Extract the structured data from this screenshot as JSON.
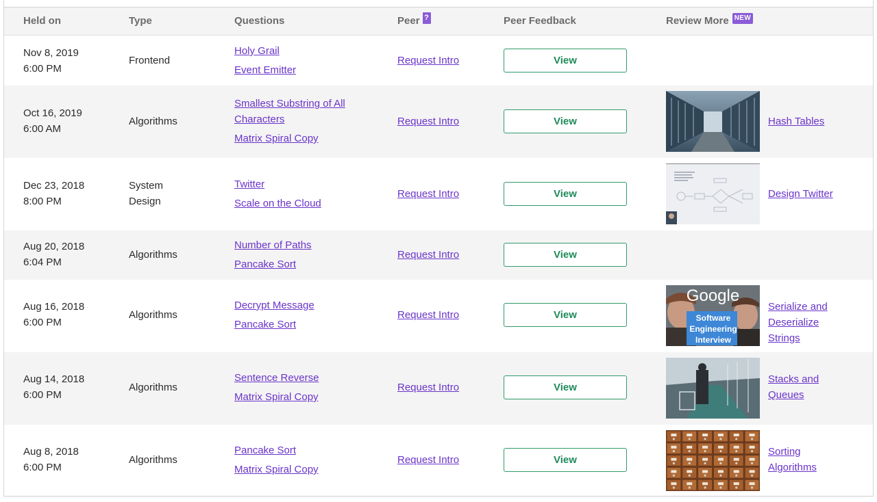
{
  "headers": {
    "held_on": "Held on",
    "type": "Type",
    "questions": "Questions",
    "peer": "Peer",
    "peer_help": "?",
    "peer_feedback": "Peer Feedback",
    "review_more": "Review More",
    "new_badge": "NEW"
  },
  "rows": [
    {
      "date": "Nov 8, 2019",
      "time": "6:00 PM",
      "type": "Frontend",
      "questions": [
        "Holy Grail",
        "Event Emitter"
      ],
      "peer": "Request Intro",
      "feedback": "View",
      "review": null
    },
    {
      "date": "Oct 16, 2019",
      "time": "6:00 AM",
      "type": "Algorithms",
      "questions": [
        "Smallest Substring of All Characters",
        "Matrix Spiral Copy"
      ],
      "peer": "Request Intro",
      "feedback": "View",
      "review": {
        "lines": [
          "Hash Tables"
        ],
        "thumb": "server-room-thumbnail"
      }
    },
    {
      "date": "Dec 23, 2018",
      "time": "8:00 PM",
      "type": "System Design",
      "questions": [
        "Twitter",
        "Scale on the Cloud"
      ],
      "peer": "Request Intro",
      "feedback": "View",
      "review": {
        "lines": [
          "Design Twitter"
        ],
        "thumb": "diagram-thumbnail"
      }
    },
    {
      "date": "Aug 20, 2018",
      "time": "6:04 PM",
      "type": "Algorithms",
      "questions": [
        "Number of Paths",
        "Pancake Sort"
      ],
      "peer": "Request Intro",
      "feedback": "View",
      "review": null
    },
    {
      "date": "Aug 16, 2018",
      "time": "6:00 PM",
      "type": "Algorithms",
      "questions": [
        "Decrypt Message",
        "Pancake Sort"
      ],
      "peer": "Request Intro",
      "feedback": "View",
      "review": {
        "lines": [
          "Serialize and",
          "Deserialize",
          "Strings"
        ],
        "thumb": "google-interview-thumbnail",
        "thumb_text": {
          "brand": "Google",
          "l1": "Software",
          "l2": "Engineering",
          "l3": "Interview"
        }
      }
    },
    {
      "date": "Aug 14, 2018",
      "time": "6:00 PM",
      "type": "Algorithms",
      "questions": [
        "Sentence Reverse",
        "Matrix Spiral Copy"
      ],
      "peer": "Request Intro",
      "feedback": "View",
      "review": {
        "lines": [
          "Stacks and",
          "Queues"
        ],
        "thumb": "shopping-aisle-thumbnail"
      }
    },
    {
      "date": "Aug 8, 2018",
      "time": "6:00 PM",
      "type": "Algorithms",
      "questions": [
        "Pancake Sort",
        "Matrix Spiral Copy"
      ],
      "peer": "Request Intro",
      "feedback": "View",
      "review": {
        "lines": [
          "Sorting",
          "Algorithms"
        ],
        "thumb": "card-catalog-thumbnail"
      }
    }
  ],
  "colors": {
    "link": "#6a34c9",
    "button_green": "#1f8a5a",
    "badge_purple": "#8b5cd6",
    "stripe": "#f4f4f4"
  }
}
